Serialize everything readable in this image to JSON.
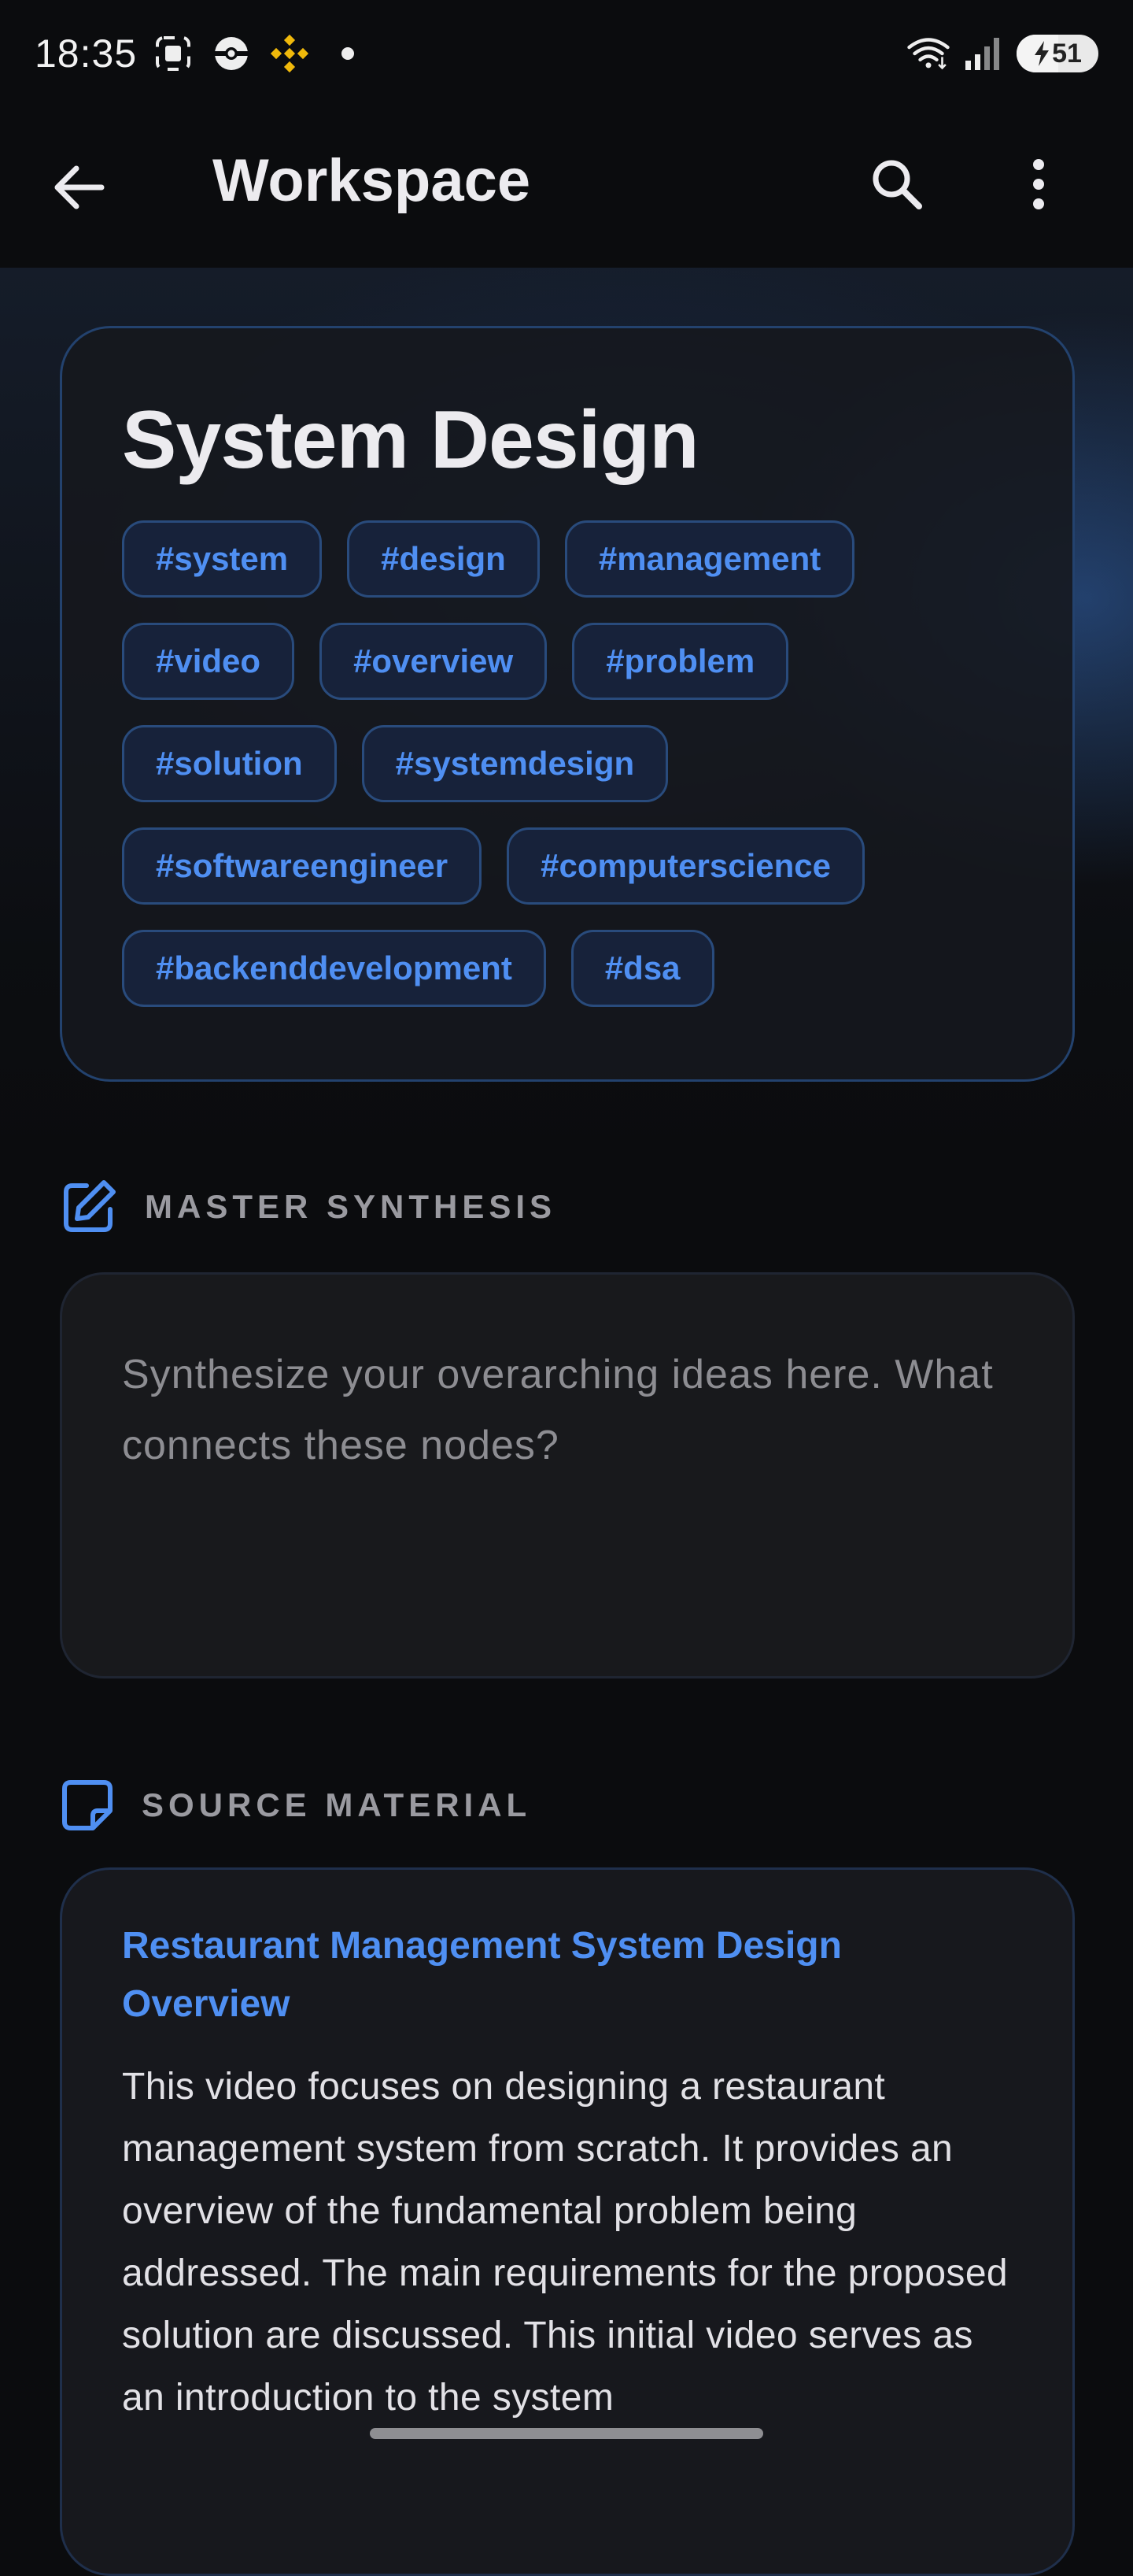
{
  "status_bar": {
    "time": "18:35",
    "battery_level": "51"
  },
  "app_bar": {
    "title": "Workspace"
  },
  "topic": {
    "title": "System Design",
    "tags": [
      "#system",
      "#design",
      "#management",
      "#video",
      "#overview",
      "#problem",
      "#solution",
      "#systemdesign",
      "#softwareengineer",
      "#computerscience",
      "#backenddevelopment",
      "#dsa"
    ]
  },
  "synthesis": {
    "label": "MASTER SYNTHESIS",
    "placeholder": "Synthesize your overarching ideas here. What connects these nodes?"
  },
  "source": {
    "label": "SOURCE MATERIAL",
    "title": "Restaurant Management System Design Overview",
    "body": "This video focuses on designing a restaurant management system from scratch. It provides an overview of the fundamental problem being addressed. The main requirements for the proposed solution are discussed. This initial video serves as an introduction to the system"
  },
  "colors": {
    "accent": "#4f8ff2",
    "background": "#0b0c0e",
    "card_border": "#23426e"
  }
}
